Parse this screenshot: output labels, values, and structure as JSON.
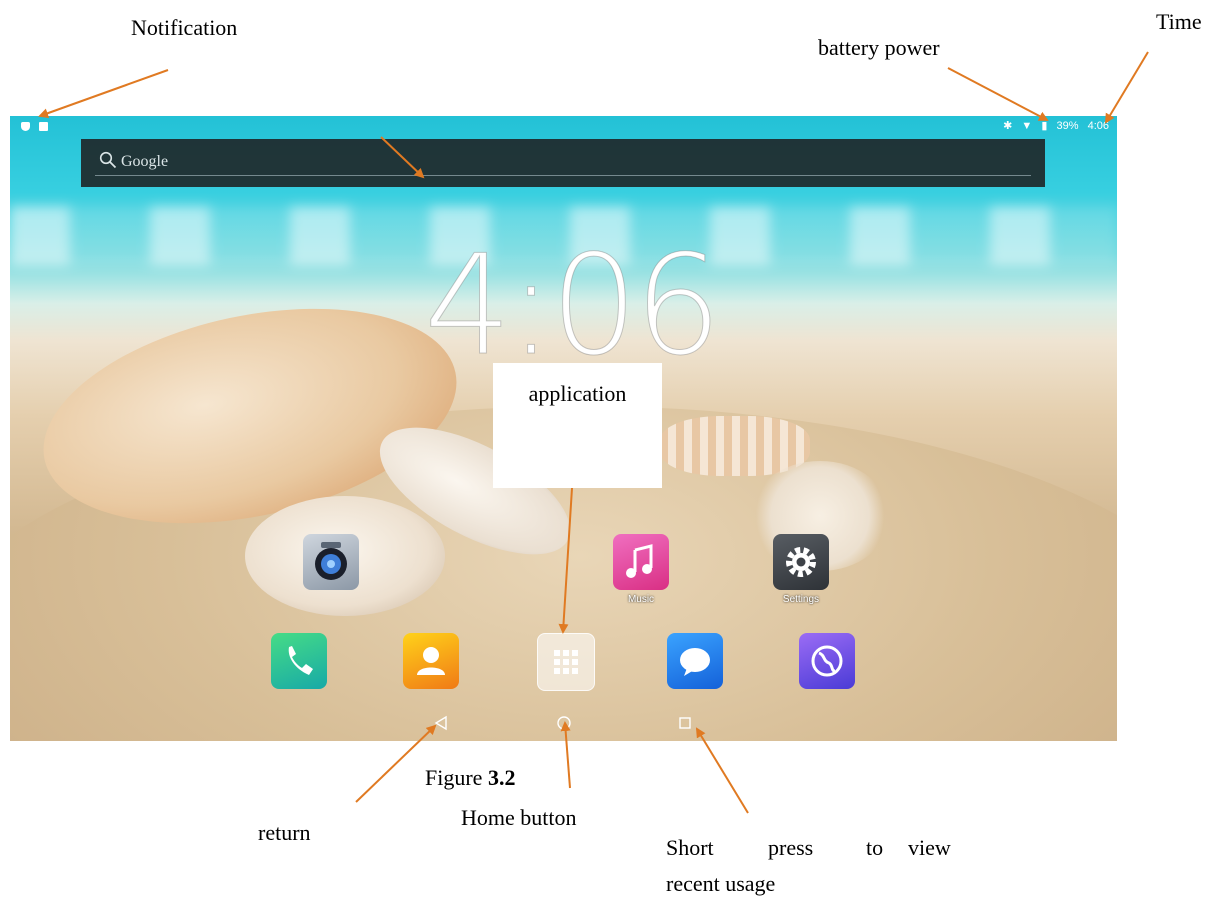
{
  "annotations": {
    "notification": "Notification",
    "battery_power": "battery power",
    "time": "Time",
    "application": "application",
    "figure_prefix": "Figure",
    "figure_number": "3.2",
    "return": "return",
    "home_button": "Home button",
    "recent_line1_words": [
      "Short",
      "press",
      "to",
      "view"
    ],
    "recent_line2": "recent usage"
  },
  "statusbar": {
    "battery_percent": "39%",
    "time": "4:06"
  },
  "search": {
    "label": "Google"
  },
  "clock": {
    "time": "4:06"
  },
  "apps": {
    "music_label": "Music",
    "settings_label": "Settings"
  },
  "colors": {
    "arrow": "#e07a22",
    "phone": "#2fc46f",
    "contacts": "#f0a21a",
    "messages": "#1b7be6",
    "browser": "#6a4be0",
    "music": "#e84aa2",
    "settings": "#3d4147"
  }
}
